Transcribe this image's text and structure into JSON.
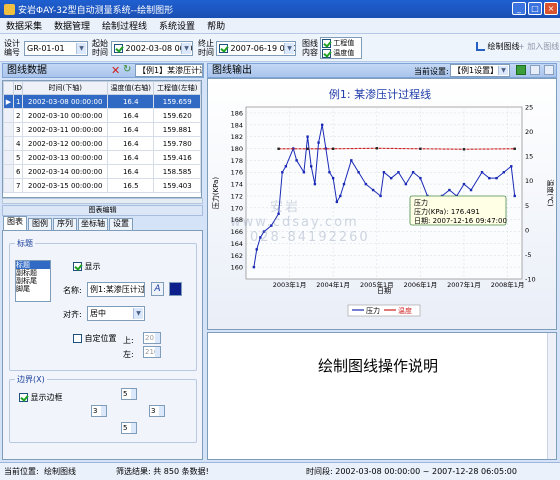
{
  "window": {
    "title": "安岩ΦAY-32型自动测量系统--绘制图形",
    "min": "_",
    "max": "□",
    "close": "×"
  },
  "menu": [
    "数据采集",
    "数据管理",
    "绘制过程线",
    "系统设置",
    "帮助"
  ],
  "toolbar": {
    "design_label1": "设计",
    "design_label2": "编号",
    "design_value": "GR-01-01",
    "start_label1": "起始",
    "start_label2": "时间",
    "start_value": "2002-03-08 00:00:00",
    "end_label1": "终止",
    "end_label2": "时间",
    "end_value": "2007-06-19 00:00:00",
    "content_label1": "图线",
    "content_label2": "内容",
    "opt_engineering": "工程值",
    "opt_temperature": "温度值",
    "draw_btn": "绘制图线",
    "add_btn": "加入图线"
  },
  "data_panel": {
    "title": "图线数据",
    "preset": "【例1】某渗压计过",
    "columns": [
      "ID",
      "时间(下轴)",
      "温度值(右轴)",
      "工程值(左轴)"
    ],
    "rows": [
      [
        "1",
        "2002-03-08 00:00:00",
        "16.4",
        "159.659"
      ],
      [
        "2",
        "2002-03-10 00:00:00",
        "16.4",
        "159.620"
      ],
      [
        "3",
        "2002-03-11 00:00:00",
        "16.4",
        "159.881"
      ],
      [
        "4",
        "2002-03-12 00:00:00",
        "16.4",
        "159.780"
      ],
      [
        "5",
        "2002-03-13 00:00:00",
        "16.4",
        "159.416"
      ],
      [
        "6",
        "2002-03-14 00:00:00",
        "16.4",
        "158.585"
      ],
      [
        "7",
        "2002-03-15 00:00:00",
        "16.5",
        "159.403"
      ]
    ]
  },
  "edit_panel": {
    "title": "图表编辑",
    "tabs": [
      "图表",
      "图例",
      "序列",
      "坐标轴",
      "设置"
    ],
    "title_group": "标题",
    "title_list": [
      "标题",
      "副标题",
      "副标尾",
      "脚尾"
    ],
    "show_label": "显示",
    "name_label": "名称:",
    "name_value": "例1:某渗压计过程",
    "align_label": "对齐:",
    "align_value": "居中",
    "custom_pos": "自定位置",
    "up_label": "上:",
    "left_label": "左:",
    "up_value": "20",
    "left_value": "210",
    "border_group": "边界(X)",
    "show_border": "显示边框",
    "spin_vals": [
      "5",
      "3",
      "3",
      "5"
    ]
  },
  "chart_panel": {
    "title": "图线输出",
    "current_setting_label": "当前设置:",
    "current_setting_value": "【例1设置】"
  },
  "chart_data": {
    "type": "line",
    "title": "例1: 某渗压计过程线",
    "ylabel": "压力(KPa)",
    "y2label": "温度(℃)",
    "xlabel": "日期",
    "x_ticks": [
      "2003年1月",
      "2004年1月",
      "2005年1月",
      "2006年1月",
      "2007年1月",
      "2008年1月"
    ],
    "ylim": [
      158,
      187
    ],
    "y_ticks": [
      160,
      162,
      164,
      166,
      168,
      170,
      172,
      174,
      176,
      178,
      180,
      182,
      184,
      186
    ],
    "y2lim": [
      -10,
      25
    ],
    "y2_ticks": [
      -10,
      -5,
      0,
      5,
      10,
      15,
      20,
      25
    ],
    "series": [
      {
        "name": "压力",
        "color": "#1a2ab5",
        "points": [
          [
            "2002-03-08",
            160
          ],
          [
            "2002-04-01",
            163
          ],
          [
            "2002-05-01",
            165
          ],
          [
            "2002-06-01",
            166
          ],
          [
            "2002-08-01",
            167
          ],
          [
            "2002-10-01",
            169
          ],
          [
            "2002-11-01",
            176
          ],
          [
            "2002-12-01",
            177
          ],
          [
            "2003-02-01",
            180
          ],
          [
            "2003-03-01",
            178
          ],
          [
            "2003-05-01",
            176
          ],
          [
            "2003-06-01",
            182
          ],
          [
            "2003-07-01",
            177
          ],
          [
            "2003-08-01",
            174
          ],
          [
            "2003-09-01",
            181
          ],
          [
            "2003-10-01",
            184
          ],
          [
            "2003-11-01",
            180
          ],
          [
            "2003-12-01",
            176
          ],
          [
            "2004-01-01",
            175
          ],
          [
            "2004-02-01",
            171
          ],
          [
            "2004-03-01",
            172
          ],
          [
            "2004-04-01",
            174
          ],
          [
            "2004-06-01",
            178
          ],
          [
            "2004-08-01",
            176
          ],
          [
            "2004-10-01",
            174
          ],
          [
            "2004-12-01",
            173
          ],
          [
            "2005-02-01",
            172
          ],
          [
            "2005-03-01",
            176
          ],
          [
            "2005-05-01",
            175
          ],
          [
            "2005-07-01",
            176
          ],
          [
            "2005-09-01",
            174
          ],
          [
            "2005-11-01",
            176
          ],
          [
            "2006-01-01",
            175
          ],
          [
            "2006-03-01",
            172
          ],
          [
            "2006-05-01",
            171
          ],
          [
            "2006-07-01",
            172
          ],
          [
            "2006-09-01",
            173
          ],
          [
            "2006-11-01",
            172
          ],
          [
            "2007-01-01",
            174
          ],
          [
            "2007-03-01",
            173
          ],
          [
            "2007-06-01",
            176
          ],
          [
            "2007-08-01",
            175
          ],
          [
            "2007-10-01",
            175
          ],
          [
            "2007-12-01",
            176
          ],
          [
            "2008-02-01",
            177
          ],
          [
            "2008-03-01",
            172
          ]
        ]
      },
      {
        "name": "温度",
        "color": "#cc2020",
        "points": [
          [
            "2002-10-01",
            16.5
          ],
          [
            "2003-06-01",
            16.5
          ],
          [
            "2004-01-01",
            16.5
          ],
          [
            "2005-01-01",
            16.6
          ],
          [
            "2006-01-01",
            16.5
          ],
          [
            "2007-01-01",
            16.4
          ],
          [
            "2008-03-01",
            16.5
          ]
        ]
      }
    ],
    "tooltip": {
      "line1": "压力",
      "line2": "压力(KPa): 176.491",
      "line3": "日期: 2007-12-16 09:47:00"
    }
  },
  "description_panel": {
    "text": "绘制图线操作说明"
  },
  "statusbar": {
    "pos_label": "当前位置:",
    "pos_value": "绘制图线",
    "filter": "筛选结果: 共 850 条数据!",
    "range": "时间段: 2002-03-08 00:00:00 ~ 2007-12-28 06:05:00"
  },
  "watermark": [
    "安岩",
    "www.cdsay.com",
    "028-84192260"
  ]
}
